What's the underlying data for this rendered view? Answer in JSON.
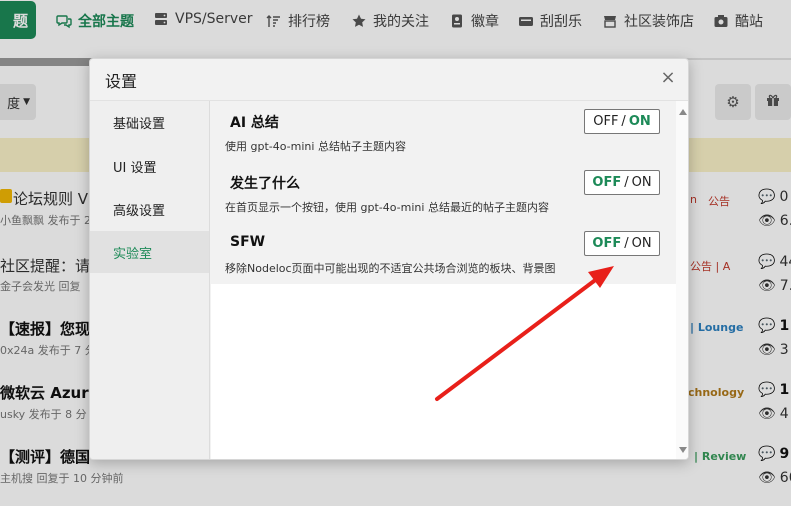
{
  "nav": {
    "brand": "题",
    "items": [
      {
        "label": "全部主题",
        "active": true
      },
      {
        "label": "VPS/Server"
      },
      {
        "label": "排行榜"
      },
      {
        "label": "我的关注"
      },
      {
        "label": "徽章"
      },
      {
        "label": "刮刮乐"
      },
      {
        "label": "社区装饰店"
      },
      {
        "label": "酷站"
      }
    ]
  },
  "toolbar": {
    "dropdown_label": "度"
  },
  "topics": [
    {
      "title": "论坛规则 V",
      "meta": "小鱼飘飘 发布于 2",
      "tags": [
        "n",
        "公告"
      ],
      "replies": "0",
      "views": "6."
    },
    {
      "title": "社区提醒：请",
      "meta": "金子会发光 回复",
      "tags": [
        "公告 | A"
      ],
      "replies": "44",
      "views": "7."
    },
    {
      "title": "【速报】您现",
      "meta": "0x24a 发布于 7 分",
      "tags": [
        "| Lounge"
      ],
      "replies": "1",
      "views": "3"
    },
    {
      "title": "微软云 Azure",
      "meta": "usky 发布于 8 分",
      "tags": [
        "chnology"
      ],
      "replies": "1",
      "views": "4"
    },
    {
      "title": "【测评】德国",
      "meta": "主机搜 回复于 10 分钟前",
      "tags": [
        "| Review"
      ],
      "replies": "9",
      "views": "60"
    }
  ],
  "modal": {
    "title": "设置",
    "close": "×",
    "sidebar": [
      {
        "label": "基础设置"
      },
      {
        "label": "UI 设置"
      },
      {
        "label": "高级设置"
      },
      {
        "label": "实验室",
        "active": true
      }
    ],
    "settings": [
      {
        "title": "AI 总结",
        "desc": "使用 gpt-4o-mini 总结帖子主题内容",
        "off": "OFF",
        "on": "ON",
        "state": "on"
      },
      {
        "title": "发生了什么",
        "desc": "在首页显示一个按钮，使用 gpt-4o-mini 总结最近的帖子主题内容",
        "off": "OFF",
        "on": "ON",
        "state": "off"
      },
      {
        "title": "SFW",
        "desc": "移除Nodeloc页面中可能出现的不适宜公共场合浏览的板块、背景图",
        "off": "OFF",
        "on": "ON",
        "state": "off"
      }
    ]
  },
  "colors": {
    "accent": "#1d8a58",
    "annotation_arrow": "#e8201a",
    "banner": "#faf1c8"
  },
  "icons": {
    "nav": [
      "comments-icon",
      "server-icon",
      "ranking-icon",
      "star-icon",
      "badge-icon",
      "scratch-card-icon",
      "shop-icon",
      "camera-icon"
    ],
    "toolbar": [
      "gear-icon",
      "gift-icon"
    ]
  }
}
